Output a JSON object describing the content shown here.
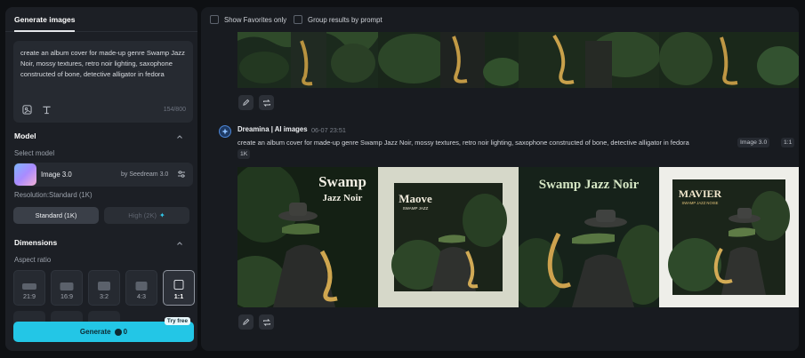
{
  "left_panel": {
    "tab_label": "Generate images",
    "prompt": {
      "text": "create an album cover for made-up genre Swamp Jazz Noir, mossy textures, retro noir lighting, saxophone constructed of bone, detective alligator in fedora",
      "char_count": "154/800"
    },
    "model_section": {
      "title": "Model",
      "select_label": "Select model",
      "model_name": "Image 3.0",
      "model_by": "by Seedream 3.0",
      "resolution_label": "Resolution:Standard (1K)",
      "res_standard": "Standard (1K)",
      "res_high": "High (2K)"
    },
    "dimensions_section": {
      "title": "Dimensions",
      "aspect_label": "Aspect ratio",
      "ratios": [
        "21:9",
        "16:9",
        "3:2",
        "4:3",
        "1:1"
      ],
      "selected_ratio": "1:1"
    },
    "generate": {
      "label": "Generate",
      "cost": "0",
      "badge": "Try free"
    }
  },
  "right_panel": {
    "filters": {
      "favorites": "Show Favorites only",
      "group": "Group results by prompt"
    },
    "generation": {
      "author": "Dreamina | AI images",
      "time": "06-07  23:51",
      "prompt": "create an album cover for made-up genre Swamp Jazz Noir, mossy textures, retro noir lighting, saxophone constructed of bone, detective alligator in fedora",
      "chips": [
        "Image 3.0",
        "1:1",
        "1K"
      ],
      "images": [
        {
          "title_line1": "Swamp",
          "title_line2": "Jazz Noir"
        },
        {
          "title_line1": "Maove",
          "title_line2": "SWAMP JAZZ"
        },
        {
          "title_line1": "Swamp Jazz Noir",
          "title_line2": ""
        },
        {
          "title_line1": "MAVIER",
          "title_line2": "SWAMP JAZZ NOISE"
        }
      ]
    }
  },
  "colors": {
    "accent": "#23c6e6",
    "panel": "#1c1f25",
    "canvas": "#181b20"
  }
}
